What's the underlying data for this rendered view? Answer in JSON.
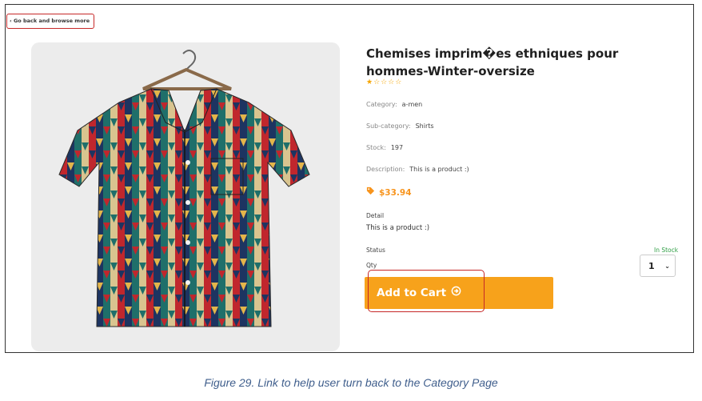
{
  "back_link": {
    "label": "Go back and browse more",
    "icon": "chevron-left-icon"
  },
  "product": {
    "title": "Chemises imprim�es ethniques pour hommes-Winter-oversize",
    "rating_stars": "★☆☆☆☆",
    "rating": 1,
    "category_label": "Category:",
    "category_value": "a-men",
    "subcategory_label": "Sub-category:",
    "subcategory_value": "Shirts",
    "stock_label": "Stock:",
    "stock_value": "197",
    "description_label": "Description:",
    "description_value": "This is a product :)",
    "price": "$33.94",
    "price_icon": "price-tag-icon",
    "detail_label": "Detail",
    "detail_text": "This is a product :)",
    "status_label": "Status",
    "status_value": "In Stock",
    "qty_label": "Qty",
    "qty_value": "1",
    "add_to_cart_label": "Add to Cart",
    "add_to_cart_icon": "arrow-circle-right-icon"
  },
  "colors": {
    "accent": "#f7a21b",
    "price": "#f7941d",
    "highlight": "#c62828",
    "in_stock": "#2e9e44",
    "caption": "#3f5e8c"
  },
  "caption": "Figure 29. Link to help user turn back to the Category Page"
}
